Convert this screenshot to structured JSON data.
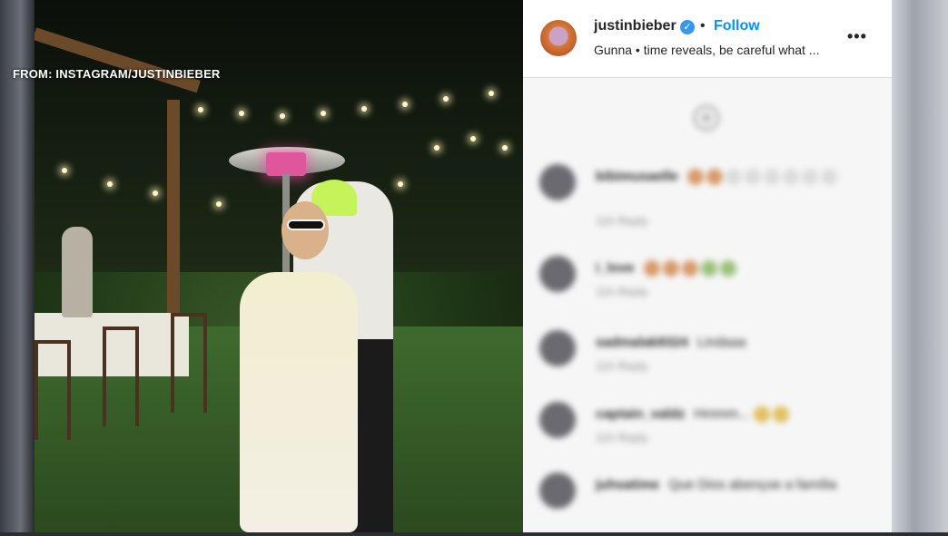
{
  "watermark": "FROM: INSTAGRAM/JUSTINBIEBER",
  "post": {
    "username": "justinbieber",
    "separator": "•",
    "follow_label": "Follow",
    "audio_line": "Gunna • time reveals, be careful what ...",
    "more_label": "•••"
  },
  "colors": {
    "accent": "#0095f6",
    "verified": "#3897f0",
    "text": "#262626",
    "muted": "#8e8e8e"
  },
  "comments": [
    {
      "user": "bibimusaelle",
      "text": "",
      "meta": "11h  Reply",
      "emoji_colors": [
        "#d89a6a",
        "#d89a6a",
        "#d8d8d8",
        "#d8d8d8",
        "#d8d8d8",
        "#d8d8d8",
        "#d8d8d8",
        "#d8d8d8"
      ]
    },
    {
      "user": "i_love",
      "text": "",
      "meta": "11h  Reply",
      "emoji_colors": [
        "#d89a6a",
        "#d89a6a",
        "#d89a6a",
        "#9ac27a",
        "#9ac27a"
      ]
    },
    {
      "user": "sadmalak8324",
      "text": "Lindaaa",
      "meta": "11h  Reply",
      "emoji_colors": []
    },
    {
      "user": "captain_valdz",
      "text": "Hmmm...",
      "meta": "11h  Reply",
      "emoji_colors": [
        "#e0c060",
        "#e0c060"
      ]
    },
    {
      "user": "juhsatime",
      "text": "Que Dios abençoe a família",
      "meta": "",
      "emoji_colors": []
    }
  ],
  "icons": {
    "verified": "verified-badge-icon",
    "more": "more-options-icon",
    "add": "add-comment-icon"
  }
}
